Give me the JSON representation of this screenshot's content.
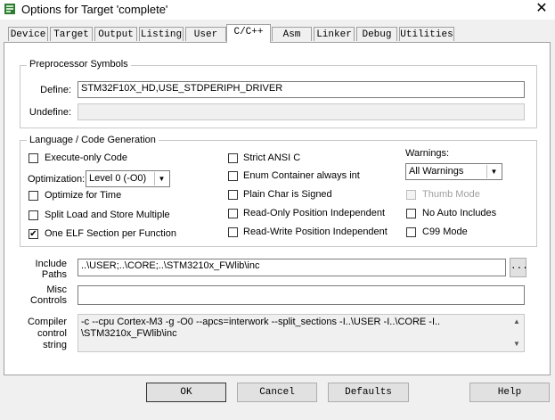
{
  "window": {
    "title": "Options for Target 'complete'"
  },
  "tabs": [
    {
      "label": "Device"
    },
    {
      "label": "Target"
    },
    {
      "label": "Output"
    },
    {
      "label": "Listing"
    },
    {
      "label": "User"
    },
    {
      "label": "C/C++"
    },
    {
      "label": "Asm"
    },
    {
      "label": "Linker"
    },
    {
      "label": "Debug"
    },
    {
      "label": "Utilities"
    }
  ],
  "preprocessor": {
    "title": "Preprocessor Symbols",
    "define_label": "Define:",
    "define_value": "STM32F10X_HD,USE_STDPERIPH_DRIVER",
    "undefine_label": "Undefine:",
    "undefine_value": ""
  },
  "language": {
    "title": "Language / Code Generation",
    "execute_only": {
      "label": "Execute-only Code",
      "checked": false
    },
    "optimization_label": "Optimization:",
    "optimization_value": "Level 0 (-O0)",
    "optimize_time": {
      "label": "Optimize for Time",
      "checked": false
    },
    "split_load": {
      "label": "Split Load and Store Multiple",
      "checked": false
    },
    "one_elf": {
      "label": "One ELF Section per Function",
      "checked": true
    },
    "strict_ansi": {
      "label": "Strict ANSI C",
      "checked": false
    },
    "enum_container": {
      "label": "Enum Container always int",
      "checked": false
    },
    "plain_char": {
      "label": "Plain Char is Signed",
      "checked": false
    },
    "ro_position": {
      "label": "Read-Only Position Independent",
      "checked": false
    },
    "rw_position": {
      "label": "Read-Write Position Independent",
      "checked": false
    },
    "warnings_label": "Warnings:",
    "warnings_value": "All Warnings",
    "thumb_mode": {
      "label": "Thumb Mode",
      "checked": false,
      "disabled": true
    },
    "no_auto_includes": {
      "label": "No Auto Includes",
      "checked": false
    },
    "c99_mode": {
      "label": "C99 Mode",
      "checked": false
    }
  },
  "include_paths": {
    "label_line1": "Include",
    "label_line2": "Paths",
    "value": "..\\USER;..\\CORE;..\\STM3210x_FWlib\\inc",
    "browse_label": "..."
  },
  "misc_controls": {
    "label_line1": "Misc",
    "label_line2": "Controls",
    "value": ""
  },
  "compiler": {
    "label_line1": "Compiler",
    "label_line2": "control",
    "label_line3": "string",
    "line1": "-c --cpu Cortex-M3 -g -O0 --apcs=interwork --split_sections -I..\\USER -I..\\CORE -I..",
    "line2": "\\STM3210x_FWlib\\inc"
  },
  "buttons": {
    "ok": "OK",
    "cancel": "Cancel",
    "defaults": "Defaults",
    "help": "Help"
  },
  "icons": {
    "checkmark": "✔",
    "dropdown": "▼",
    "scroll_up": "▲",
    "scroll_down": "▼",
    "close": "✕"
  }
}
